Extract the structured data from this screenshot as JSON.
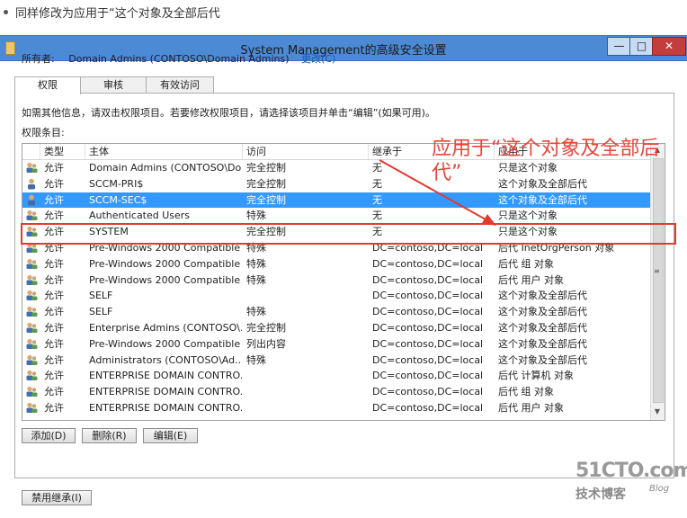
{
  "note": "同样修改为应用于“这个对象及全部后代",
  "window": {
    "title": "System Management的高级安全设置",
    "min": "—",
    "max": "□",
    "close": "✕"
  },
  "owner": {
    "label": "所有者:",
    "value": "Domain Admins (CONTOSO\\Domain Admins)",
    "change": "更改(C)"
  },
  "tabs": [
    "权限",
    "审核",
    "有效访问"
  ],
  "info": "如需其他信息，请双击权限项目。若要修改权限项目，请选择该项目并单击“编辑”(如果可用)。",
  "entries_label": "权限条目:",
  "columns": [
    "类型",
    "主体",
    "访问",
    "继承于",
    "应用于"
  ],
  "rows": [
    {
      "type": "允许",
      "principal": "Domain Admins (CONTOSO\\Do...",
      "access": "完全控制",
      "inherited": "无",
      "applies": "只是这个对象",
      "icon": "group-icon"
    },
    {
      "type": "允许",
      "principal": "SCCM-PRI$",
      "access": "完全控制",
      "inherited": "无",
      "applies": "这个对象及全部后代",
      "icon": "computer-user-icon"
    },
    {
      "type": "允许",
      "principal": "SCCM-SEC$",
      "access": "完全控制",
      "inherited": "无",
      "applies": "这个对象及全部后代",
      "icon": "computer-user-icon"
    },
    {
      "type": "允许",
      "principal": "Authenticated Users",
      "access": "特殊",
      "inherited": "无",
      "applies": "只是这个对象",
      "icon": "group-icon"
    },
    {
      "type": "允许",
      "principal": "SYSTEM",
      "access": "完全控制",
      "inherited": "无",
      "applies": "只是这个对象",
      "icon": "group-icon"
    },
    {
      "type": "允许",
      "principal": "Pre-Windows 2000 Compatible ...",
      "access": "特殊",
      "inherited": "DC=contoso,DC=local",
      "applies": "后代 InetOrgPerson 对象",
      "icon": "group-icon"
    },
    {
      "type": "允许",
      "principal": "Pre-Windows 2000 Compatible ...",
      "access": "特殊",
      "inherited": "DC=contoso,DC=local",
      "applies": "后代 组 对象",
      "icon": "group-icon"
    },
    {
      "type": "允许",
      "principal": "Pre-Windows 2000 Compatible ...",
      "access": "特殊",
      "inherited": "DC=contoso,DC=local",
      "applies": "后代 用户 对象",
      "icon": "group-icon"
    },
    {
      "type": "允许",
      "principal": "SELF",
      "access": "",
      "inherited": "DC=contoso,DC=local",
      "applies": "这个对象及全部后代",
      "icon": "group-icon"
    },
    {
      "type": "允许",
      "principal": "SELF",
      "access": "特殊",
      "inherited": "DC=contoso,DC=local",
      "applies": "这个对象及全部后代",
      "icon": "group-icon"
    },
    {
      "type": "允许",
      "principal": "Enterprise Admins (CONTOSO\\...",
      "access": "完全控制",
      "inherited": "DC=contoso,DC=local",
      "applies": "这个对象及全部后代",
      "icon": "group-icon"
    },
    {
      "type": "允许",
      "principal": "Pre-Windows 2000 Compatible ...",
      "access": "列出内容",
      "inherited": "DC=contoso,DC=local",
      "applies": "这个对象及全部后代",
      "icon": "group-icon"
    },
    {
      "type": "允许",
      "principal": "Administrators (CONTOSO\\Ad...",
      "access": "特殊",
      "inherited": "DC=contoso,DC=local",
      "applies": "这个对象及全部后代",
      "icon": "group-icon"
    },
    {
      "type": "允许",
      "principal": "ENTERPRISE DOMAIN CONTRO...",
      "access": "",
      "inherited": "DC=contoso,DC=local",
      "applies": "后代 计算机 对象",
      "icon": "group-icon"
    },
    {
      "type": "允许",
      "principal": "ENTERPRISE DOMAIN CONTRO...",
      "access": "",
      "inherited": "DC=contoso,DC=local",
      "applies": "后代 组 对象",
      "icon": "group-icon"
    },
    {
      "type": "允许",
      "principal": "ENTERPRISE DOMAIN CONTRO...",
      "access": "",
      "inherited": "DC=contoso,DC=local",
      "applies": "后代 用户 对象",
      "icon": "group-icon"
    }
  ],
  "selected_row": 2,
  "buttons": {
    "add": "添加(D)",
    "remove": "删除(R)",
    "edit": "编辑(E)",
    "disable_inherit": "禁用继承(I)"
  },
  "annotation": "应用于“这个对象及全部后代”",
  "watermark": {
    "site": "51CTO.com",
    "sub": "技术博客",
    "blog": "Blog"
  },
  "colors": {
    "title_bar": "#4d8ad6",
    "selection": "#3399ff",
    "annotation": "#e8463a",
    "close_button": "#c43c3c"
  }
}
